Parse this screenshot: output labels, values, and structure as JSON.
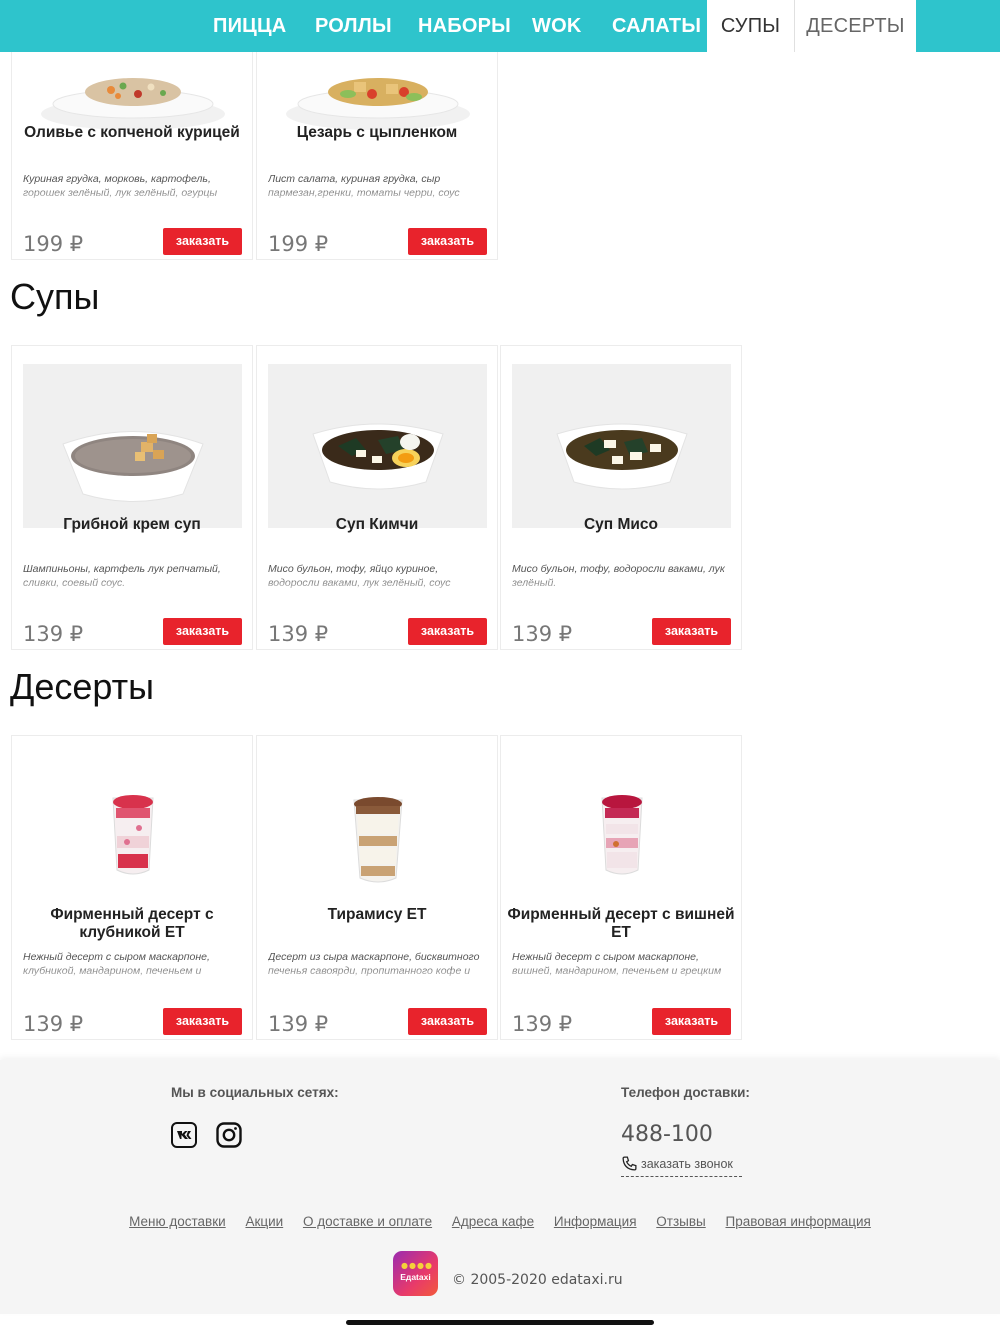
{
  "nav": {
    "tabs": [
      {
        "label": "ПИЦЦА"
      },
      {
        "label": "РОЛЛЫ"
      },
      {
        "label": "НАБОРЫ"
      },
      {
        "label": "WOK"
      },
      {
        "label": "САЛАТЫ"
      },
      {
        "label": "СУПЫ"
      },
      {
        "label": "ДЕСЕРТЫ"
      }
    ],
    "active": "СУПЫ",
    "color": "#2ec4cc"
  },
  "salads": [
    {
      "title": "Оливье с копченой курицей",
      "desc": "Куриная грудка, морковь, картофель, горошек зелёный, лук зелёный, огурцы",
      "price": "199 ₽",
      "button": "заказать"
    },
    {
      "title": "Цезарь с цыпленком",
      "desc": "Лист салата, куриная грудка, сыр пармезан,гренки, томаты черри, соус",
      "price": "199 ₽",
      "button": "заказать"
    }
  ],
  "soups": {
    "heading": "Супы",
    "items": [
      {
        "title": "Грибной крем суп",
        "desc": "Шампиньоны, картфель лук репчатый, сливки, соевый соус.",
        "price": "139 ₽",
        "button": "заказать"
      },
      {
        "title": "Суп Кимчи",
        "desc": "Мисо бульон, тофу, яйцо куриное, водоросли ваками, лук зелёный, соус шрирача, масло",
        "price": "139 ₽",
        "button": "заказать"
      },
      {
        "title": "Суп Мисо",
        "desc": "Мисо бульон, тофу, водоросли ваками, лук зелёный.",
        "price": "139 ₽",
        "button": "заказать"
      }
    ]
  },
  "desserts": {
    "heading": "Десерты",
    "items": [
      {
        "title": "Фирменный десерт с клубникой ЕТ",
        "desc": "Нежный десерт с сыром маскарпоне, клубникой, мандарином, печеньем и грецким",
        "price": "139 ₽",
        "button": "заказать"
      },
      {
        "title": "Тирамису ЕТ",
        "desc": "Десерт из сыра маскарпоне, бисквитного печенья савоярди, пропитанного кофе и",
        "price": "139 ₽",
        "button": "заказать"
      },
      {
        "title": "Фирменный десерт с вишней ЕТ",
        "desc": "Нежный десерт с сыром маскарпоне, вишней, мандарином, печеньем и грецким",
        "price": "139 ₽",
        "button": "заказать"
      }
    ]
  },
  "footer": {
    "social_label": "Мы в социальных сетях:",
    "phone_label": "Телефон доставки:",
    "phone": "488-100",
    "callback": "заказать звонок",
    "links": [
      "Меню доставки",
      "Акции",
      "О доставке и оплате",
      "Адреса кафе",
      "Информация",
      "Отзывы",
      "Правовая информация"
    ],
    "logo_text": "Едаtaxi",
    "copyright": "© 2005-2020 edataxi.ru"
  },
  "colors": {
    "accent": "#2ec4cc",
    "button": "#e8232c"
  }
}
